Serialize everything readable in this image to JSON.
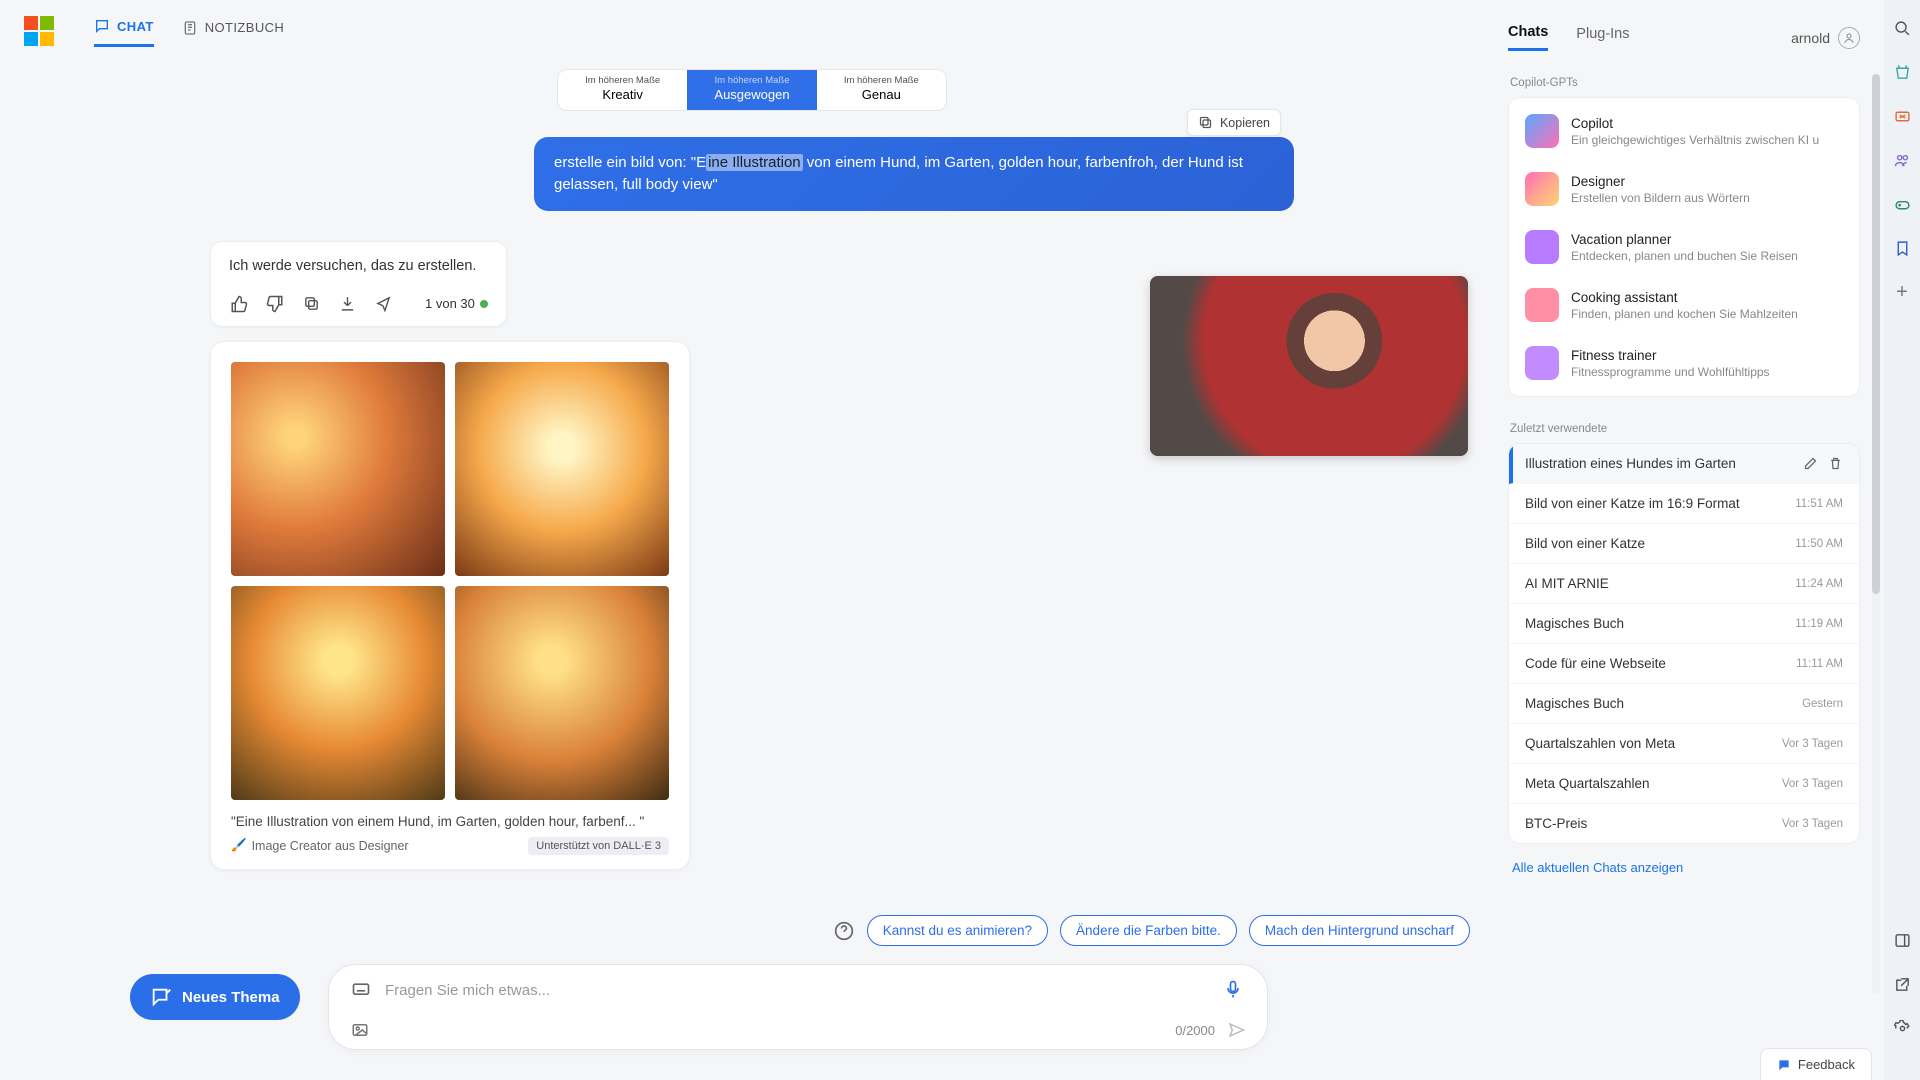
{
  "header": {
    "tab_chat": "CHAT",
    "tab_notebook": "NOTIZBUCH"
  },
  "tone": {
    "sub": "Im höheren Maße",
    "opts": [
      "Kreativ",
      "Ausgewogen",
      "Genau"
    ],
    "selected": 1
  },
  "user_msg": {
    "copy_label": "Kopieren",
    "pre": "erstelle ein bild von: \"E",
    "highlight": "ine Illustration",
    "post": " von einem Hund, im Garten, golden hour, farbenfroh, der Hund ist gelassen, full body view\""
  },
  "assistant": {
    "text": "Ich werde versuchen, das zu erstellen.",
    "counter": "1 von 30"
  },
  "image_card": {
    "caption": "\"Eine Illustration von einem Hund, im Garten, golden hour, farbenf... \"",
    "source": "Image Creator aus Designer",
    "badge": "Unterstützt von DALL·E 3"
  },
  "suggestions": [
    "Kannst du es animieren?",
    "Ändere die Farben bitte.",
    "Mach den Hintergrund unscharf"
  ],
  "input": {
    "new_topic": "Neues Thema",
    "placeholder": "Fragen Sie mich etwas...",
    "counter": "0/2000"
  },
  "right_panel": {
    "tabs": {
      "chats": "Chats",
      "plugins": "Plug-Ins"
    },
    "user_name": "arnold",
    "gpts_title": "Copilot-GPTs",
    "gpts": [
      {
        "name": "Copilot",
        "desc": "Ein gleichgewichtiges Verhältnis zwischen KI u",
        "color": "linear-gradient(135deg,#5aa7ff,#ff6fb5)"
      },
      {
        "name": "Designer",
        "desc": "Erstellen von Bildern aus Wörtern",
        "color": "linear-gradient(135deg,#ff6fb5,#ffd66f)"
      },
      {
        "name": "Vacation planner",
        "desc": "Entdecken, planen und buchen Sie Reisen",
        "color": "#b77bff"
      },
      {
        "name": "Cooking assistant",
        "desc": "Finden, planen und kochen Sie Mahlzeiten",
        "color": "#ff8fa4"
      },
      {
        "name": "Fitness trainer",
        "desc": "Fitnessprogramme und Wohlfühltipps",
        "color": "#c28cff"
      }
    ],
    "recent_title": "Zuletzt verwendete",
    "recents": [
      {
        "title": "Illustration eines Hundes im Garten",
        "time": "",
        "active": true
      },
      {
        "title": "Bild von einer Katze im 16:9 Format",
        "time": "11:51 AM"
      },
      {
        "title": "Bild von einer Katze",
        "time": "11:50 AM"
      },
      {
        "title": "AI MIT ARNIE",
        "time": "11:24 AM"
      },
      {
        "title": "Magisches Buch",
        "time": "11:19 AM"
      },
      {
        "title": "Code für eine Webseite",
        "time": "11:11 AM"
      },
      {
        "title": "Magisches Buch",
        "time": "Gestern"
      },
      {
        "title": "Quartalszahlen von Meta",
        "time": "Vor 3 Tagen"
      },
      {
        "title": "Meta Quartalszahlen",
        "time": "Vor 3 Tagen"
      },
      {
        "title": "BTC-Preis",
        "time": "Vor 3 Tagen"
      }
    ],
    "show_all": "Alle aktuellen Chats anzeigen"
  },
  "feedback": "Feedback"
}
